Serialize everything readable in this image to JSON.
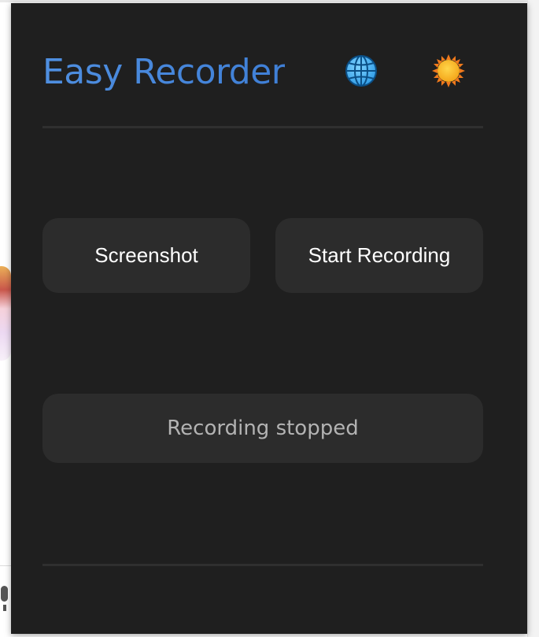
{
  "app": {
    "title": "Easy Recorder"
  },
  "header": {
    "language_icon": "globe-icon",
    "theme_icon": "sun-icon"
  },
  "actions": {
    "screenshot_label": "Screenshot",
    "record_label": "Start Recording"
  },
  "status": {
    "text": "Recording stopped"
  },
  "colors": {
    "popup_background": "#1f1f1f",
    "surface": "#2c2c2c",
    "title_accent": "#4a8ade",
    "status_text": "#b3b3b3",
    "button_text": "#ffffff",
    "divider": "#2f2f2f"
  }
}
